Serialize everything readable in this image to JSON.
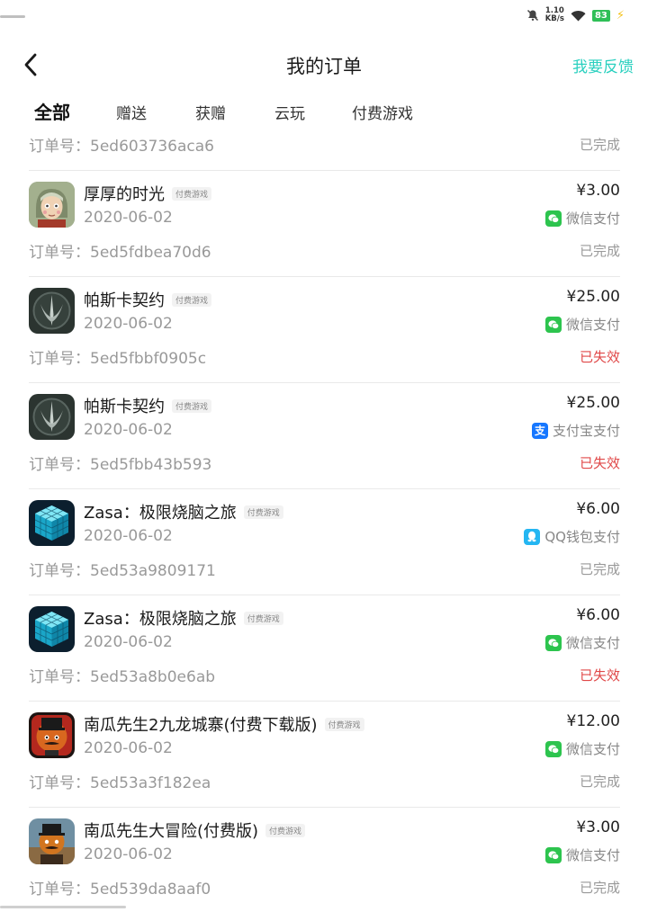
{
  "status_bar": {
    "net_speed_value": "1.10",
    "net_speed_unit": "KB/s",
    "battery": "83"
  },
  "header": {
    "title": "我的订单",
    "feedback_label": "我要反馈"
  },
  "tabs": [
    {
      "label": "全部",
      "active": true
    },
    {
      "label": "赠送",
      "active": false
    },
    {
      "label": "获赠",
      "active": false
    },
    {
      "label": "云玩",
      "active": false
    },
    {
      "label": "付费游戏",
      "active": false
    }
  ],
  "order_no_label": "订单号：",
  "partial_order": {
    "order_no": "5ed603736aca6",
    "status": "已完成"
  },
  "orders": [
    {
      "name": "厚厚的时光",
      "tag": "付费游戏",
      "date": "2020-06-02",
      "price": "¥3.00",
      "pay_method": "微信支付",
      "pay_icon": "wechat-pay-icon",
      "order_no": "5ed5fdbea70d6",
      "status": "已完成",
      "invalid": false
    },
    {
      "name": "帕斯卡契约",
      "tag": "付费游戏",
      "date": "2020-06-02",
      "price": "¥25.00",
      "pay_method": "微信支付",
      "pay_icon": "wechat-pay-icon",
      "order_no": "5ed5fbbf0905c",
      "status": "已失效",
      "invalid": true
    },
    {
      "name": "帕斯卡契约",
      "tag": "付费游戏",
      "date": "2020-06-02",
      "price": "¥25.00",
      "pay_method": "支付宝支付",
      "pay_icon": "alipay-icon",
      "order_no": "5ed5fbb43b593",
      "status": "已失效",
      "invalid": true
    },
    {
      "name": "Zasa：极限烧脑之旅",
      "tag": "付费游戏",
      "date": "2020-06-02",
      "price": "¥6.00",
      "pay_method": "QQ钱包支付",
      "pay_icon": "qq-wallet-icon",
      "order_no": "5ed53a9809171",
      "status": "已完成",
      "invalid": false
    },
    {
      "name": "Zasa：极限烧脑之旅",
      "tag": "付费游戏",
      "date": "2020-06-02",
      "price": "¥6.00",
      "pay_method": "微信支付",
      "pay_icon": "wechat-pay-icon",
      "order_no": "5ed53a8b0e6ab",
      "status": "已失效",
      "invalid": true
    },
    {
      "name": "南瓜先生2九龙城寨(付费下载版)",
      "tag": "付费游戏",
      "date": "2020-06-02",
      "price": "¥12.00",
      "pay_method": "微信支付",
      "pay_icon": "wechat-pay-icon",
      "order_no": "5ed53a3f182ea",
      "status": "已完成",
      "invalid": false
    },
    {
      "name": "南瓜先生大冒险(付费版)",
      "tag": "付费游戏",
      "date": "2020-06-02",
      "price": "¥3.00",
      "pay_method": "微信支付",
      "pay_icon": "wechat-pay-icon",
      "order_no": "5ed539da8aaf0",
      "status": "已完成",
      "invalid": false
    }
  ],
  "colors": {
    "accent": "#2ad0bf",
    "invalid": "#e04848",
    "wechat": "#2dc44e",
    "alipay": "#1677ff",
    "qq": "#24b6f2"
  }
}
